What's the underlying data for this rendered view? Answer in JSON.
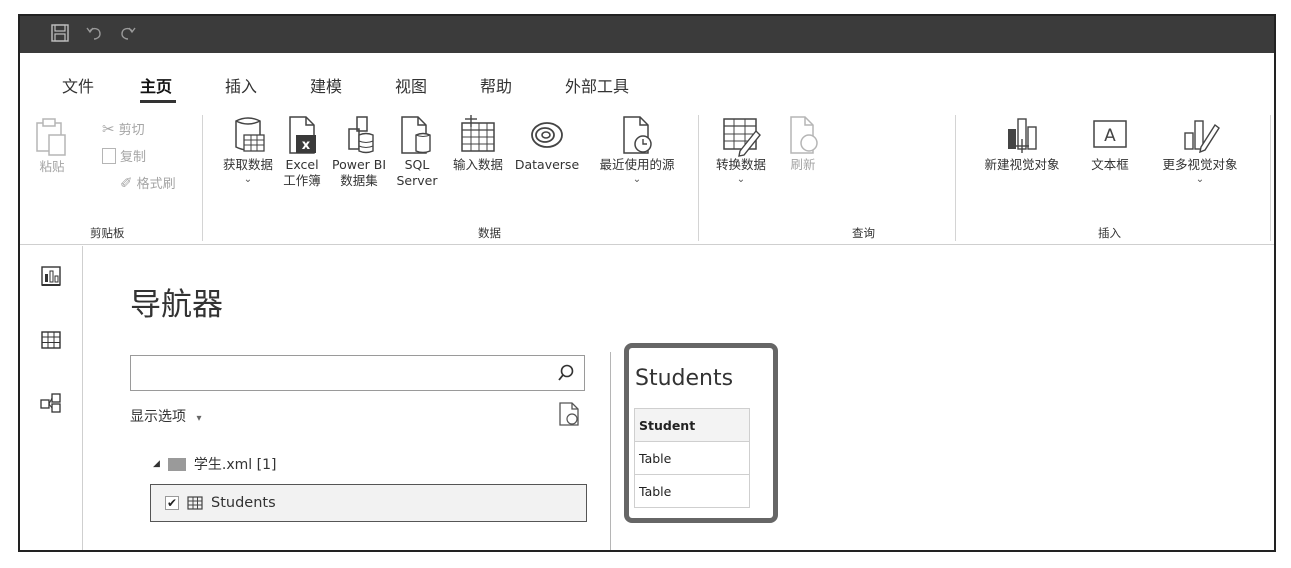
{
  "menu": {
    "tabs": [
      "文件",
      "主页",
      "插入",
      "建模",
      "视图",
      "帮助",
      "外部工具"
    ],
    "active": "主页"
  },
  "ribbon": {
    "clipboard": {
      "paste": "粘贴",
      "cut": "剪切",
      "copy": "复制",
      "format_painter": "格式刷",
      "group_label": "剪贴板"
    },
    "data": {
      "get_data": "获取数据",
      "excel_line1": "Excel",
      "excel_line2": "工作簿",
      "powerbi_line1": "Power BI",
      "powerbi_line2": "数据集",
      "sql_line1": "SQL",
      "sql_line2": "Server",
      "enter_data": "输入数据",
      "dataverse": "Dataverse",
      "recent_sources": "最近使用的源",
      "group_label": "数据"
    },
    "query": {
      "transform": "转换数据",
      "refresh": "刷新",
      "group_label": "查询"
    },
    "insert": {
      "new_visual": "新建视觉对象",
      "text_box": "文本框",
      "more_visuals": "更多视觉对象",
      "group_label": "插入"
    },
    "chevron": "⌄"
  },
  "navigator": {
    "title": "导航器",
    "search_value": "",
    "search_placeholder": "",
    "display_options": "显示选项",
    "display_options_caret": "▾",
    "folder_label": "学生.xml [1]",
    "item_label": "Students",
    "item_checked": true
  },
  "preview": {
    "title": "Students",
    "column_header": "Student",
    "rows": [
      "Table",
      "Table"
    ]
  },
  "colors": {
    "titlebar": "#3b3b3b",
    "preview_border": "#666666",
    "disabled_text": "#a5a5a5"
  }
}
